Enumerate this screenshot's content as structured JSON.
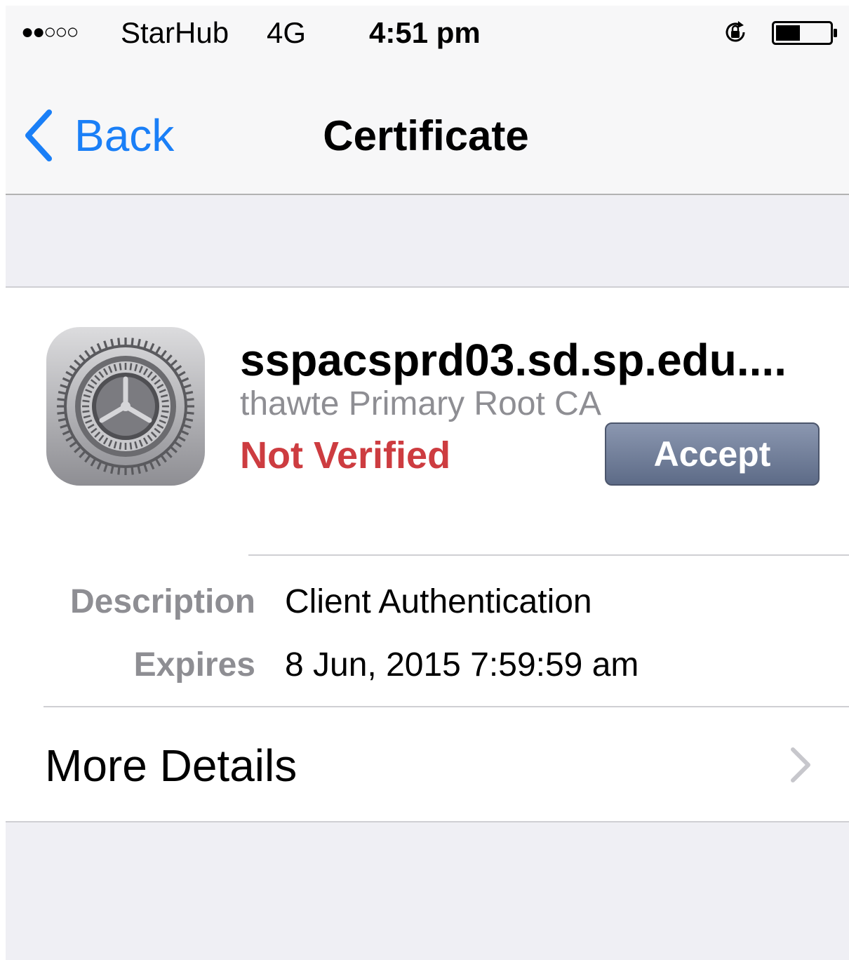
{
  "status_bar": {
    "signal": "●●○○○",
    "carrier": "StarHub",
    "network": "4G",
    "time": "4:51 pm",
    "icons": [
      "rotation-lock-icon",
      "battery-icon"
    ],
    "battery_level": 0.45
  },
  "nav": {
    "back_label": "Back",
    "title": "Certificate"
  },
  "certificate": {
    "icon": "settings-gear-icon",
    "name": "sspacsprd03.sd.sp.edu....",
    "issuer": "thawte Primary Root CA",
    "status": "Not Verified",
    "accept_label": "Accept",
    "details": [
      {
        "label": "Description",
        "value": "Client Authentication"
      },
      {
        "label": "Expires",
        "value": "8 Jun, 2015 7:59:59 am"
      }
    ],
    "more_details_label": "More Details"
  },
  "colors": {
    "accent": "#1a7ff7",
    "status_not_verified": "#cd3c40",
    "background": "#efeff4"
  }
}
